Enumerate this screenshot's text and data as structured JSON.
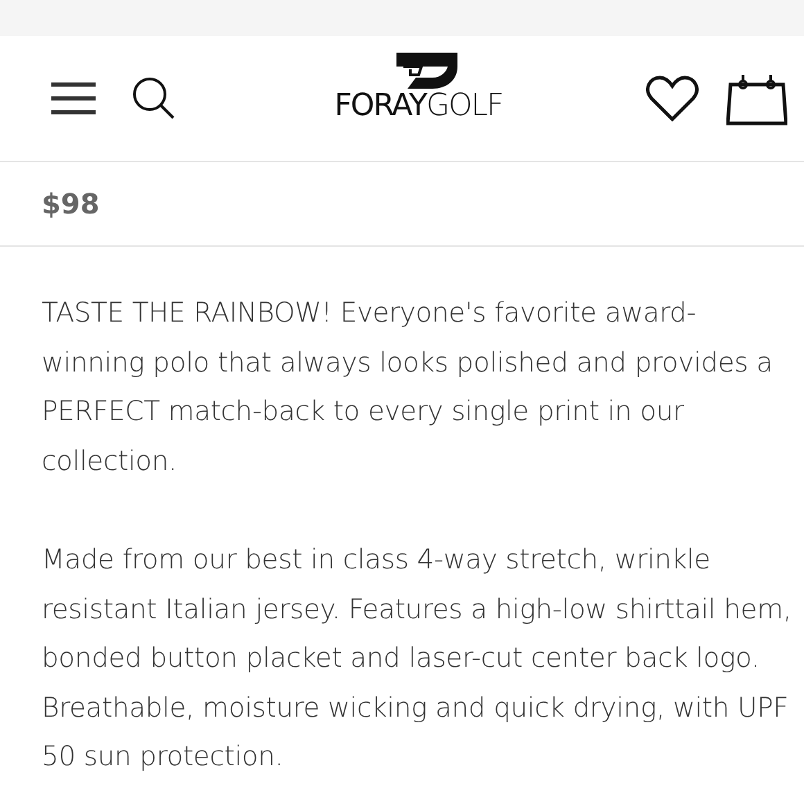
{
  "header": {
    "logo": "**FORAY**GOLF"
  },
  "product": {
    "price": "$98"
  },
  "description": [
    "TASTE THE RAINBOW! Everyone's favorite award-winning polo that always looks polished and provides a PERFECT match-back to every single print in our collection.",
    "Made from our best in class 4-way stretch, wrinkle resistant Italian jersey. Features a high-low shirttail hem, bonded button placket and laser-cut center back logo. Breathable, moisture wicking and quick drying, with UPF 50 sun protection."
  ]
}
